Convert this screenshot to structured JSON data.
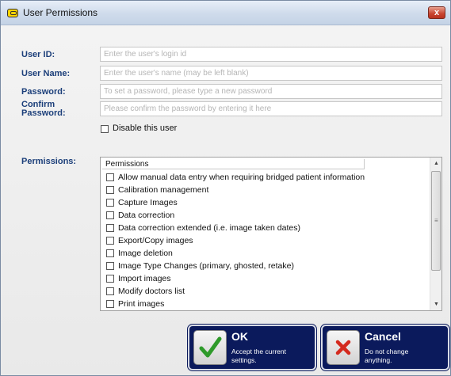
{
  "window": {
    "title": "User Permissions",
    "close_label": "x"
  },
  "fields": {
    "user_id": {
      "label": "User ID:",
      "placeholder": "Enter the user's login id"
    },
    "user_name": {
      "label": "User Name:",
      "placeholder": "Enter the user's name (may be left blank)"
    },
    "password": {
      "label": "Password:",
      "placeholder": "To set a password, please type a new password"
    },
    "confirm_password": {
      "label_line1": "Confirm",
      "label_line2": "Password:",
      "placeholder": "Please confirm the password by entering it here"
    }
  },
  "disable_user": {
    "label": "Disable this user",
    "checked": false
  },
  "permissions": {
    "label": "Permissions:",
    "column_header": "Permissions",
    "items": [
      {
        "label": "Allow manual data entry when requiring bridged patient information",
        "checked": false
      },
      {
        "label": "Calibration management",
        "checked": false
      },
      {
        "label": "Capture Images",
        "checked": false
      },
      {
        "label": "Data correction",
        "checked": false
      },
      {
        "label": "Data correction extended (i.e. image taken dates)",
        "checked": false
      },
      {
        "label": "Export/Copy images",
        "checked": false
      },
      {
        "label": "Image deletion",
        "checked": false
      },
      {
        "label": "Image Type Changes (primary, ghosted, retake)",
        "checked": false
      },
      {
        "label": "Import images",
        "checked": false
      },
      {
        "label": "Modify doctors list",
        "checked": false
      },
      {
        "label": "Print images",
        "checked": false
      }
    ],
    "scroll_up_icon": "triangle-up",
    "scroll_down_icon": "triangle-down"
  },
  "buttons": {
    "ok": {
      "title": "OK",
      "description_line1": "Accept the current",
      "description_line2": "settings.",
      "icon": "green-checkmark",
      "color": "#2e9a2a"
    },
    "cancel": {
      "title": "Cancel",
      "description_line1": "Do not change",
      "description_line2": "anything.",
      "icon": "red-x",
      "color": "#d42a1e"
    }
  },
  "colors": {
    "label_blue": "#1c3f7a",
    "button_navy": "#0b1a5c"
  }
}
